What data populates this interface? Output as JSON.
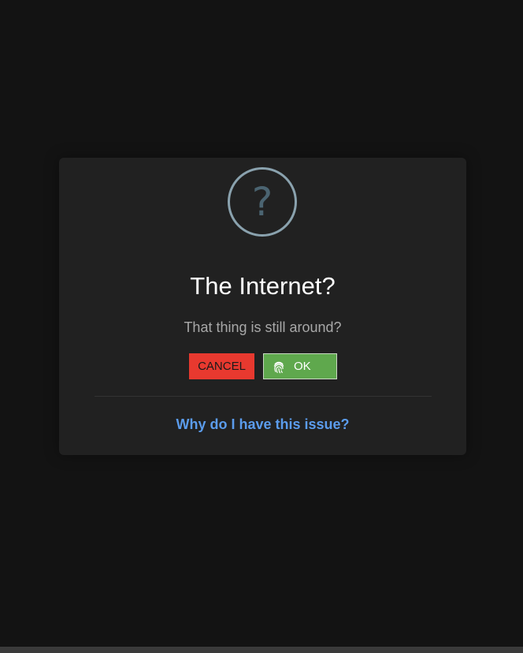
{
  "dialog": {
    "icon": "question-mark-icon",
    "icon_glyph": "?",
    "title": "The Internet?",
    "message": "That thing is still around?",
    "cancel_label": "CANCEL",
    "ok_label": "OK",
    "ok_icon": "fingerprint-icon",
    "footer_link": "Why do I have this issue?"
  },
  "colors": {
    "background": "#131313",
    "modal": "#212121",
    "cancel": "#e8392f",
    "ok": "#5fa84d",
    "link": "#5b9cec",
    "icon_ring": "#8aa2ae"
  }
}
